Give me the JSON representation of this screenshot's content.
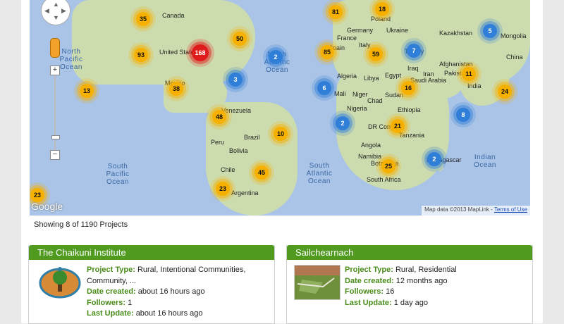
{
  "map": {
    "country_labels": [
      "Canada",
      "United States",
      "Venezuela",
      "Brazil",
      "Peru",
      "Bolivia",
      "Chile",
      "Argentina",
      "Germany",
      "Poland",
      "Ukraine",
      "France",
      "Spain",
      "Italy",
      "Turkey",
      "Kazakhstan",
      "Mongolia",
      "China",
      "Afghanistan",
      "Pakistan",
      "Iraq",
      "Iran",
      "Saudi Arabia",
      "Egypt",
      "Libya",
      "Algeria",
      "Mali",
      "Niger",
      "Chad",
      "Sudan",
      "Ethiopia",
      "Nigeria",
      "DR Congo",
      "Tanzania",
      "Angola",
      "Namibia",
      "Botswana",
      "South Africa",
      "Madagascar",
      "India",
      "Mexico"
    ],
    "ocean_labels": [
      "North Pacific Ocean",
      "North Atlantic Ocean",
      "South Pacific Ocean",
      "South Atlantic Ocean",
      "Indian Ocean"
    ],
    "clusters": [
      {
        "count": "35",
        "color": "yellow"
      },
      {
        "count": "81",
        "color": "yellow"
      },
      {
        "count": "18",
        "color": "yellow"
      },
      {
        "count": "50",
        "color": "yellow"
      },
      {
        "count": "2",
        "color": "blue"
      },
      {
        "count": "168",
        "color": "red"
      },
      {
        "count": "93",
        "color": "yellow"
      },
      {
        "count": "85",
        "color": "yellow"
      },
      {
        "count": "59",
        "color": "yellow"
      },
      {
        "count": "7",
        "color": "blue"
      },
      {
        "count": "5",
        "color": "blue"
      },
      {
        "count": "3",
        "color": "blue"
      },
      {
        "count": "38",
        "color": "yellow"
      },
      {
        "count": "13",
        "color": "yellow"
      },
      {
        "count": "6",
        "color": "blue"
      },
      {
        "count": "16",
        "color": "yellow"
      },
      {
        "count": "11",
        "color": "yellow"
      },
      {
        "count": "24",
        "color": "yellow"
      },
      {
        "count": "48",
        "color": "yellow"
      },
      {
        "count": "8",
        "color": "blue"
      },
      {
        "count": "2",
        "color": "blue"
      },
      {
        "count": "21",
        "color": "yellow"
      },
      {
        "count": "10",
        "color": "yellow"
      },
      {
        "count": "45",
        "color": "yellow"
      },
      {
        "count": "25",
        "color": "yellow"
      },
      {
        "count": "2",
        "color": "blue"
      },
      {
        "count": "23",
        "color": "yellow"
      },
      {
        "count": "23",
        "color": "yellow"
      }
    ],
    "google_label": "Google",
    "attribution": "Map data ©2013 MapLink - ",
    "terms_label": "Terms of Use"
  },
  "showing_text": "Showing 8 of 1190 Projects",
  "cards": [
    {
      "title": "The Chaikuni Institute",
      "type_key": "Project Type:",
      "type_value": "Rural, Intentional Communities, Community, ...",
      "date_key": "Date created:",
      "date_value": "about 16 hours ago",
      "followers_key": "Followers:",
      "followers_value": "1",
      "update_key": "Last Update:",
      "update_value": "about 16 hours ago"
    },
    {
      "title": "Sailchearnach",
      "type_key": "Project Type:",
      "type_value": "Rural, Residential",
      "date_key": "Date created:",
      "date_value": "12 months ago",
      "followers_key": "Followers:",
      "followers_value": "16",
      "update_key": "Last Update:",
      "update_value": "1 day ago"
    }
  ],
  "colors": {
    "card_header": "#4f9a1f",
    "cluster_yellow": "#f6b000",
    "cluster_blue": "#2f7ed8",
    "cluster_red": "#e01b1b",
    "ocean": "#a9c4e7",
    "land": "#cddcae"
  }
}
